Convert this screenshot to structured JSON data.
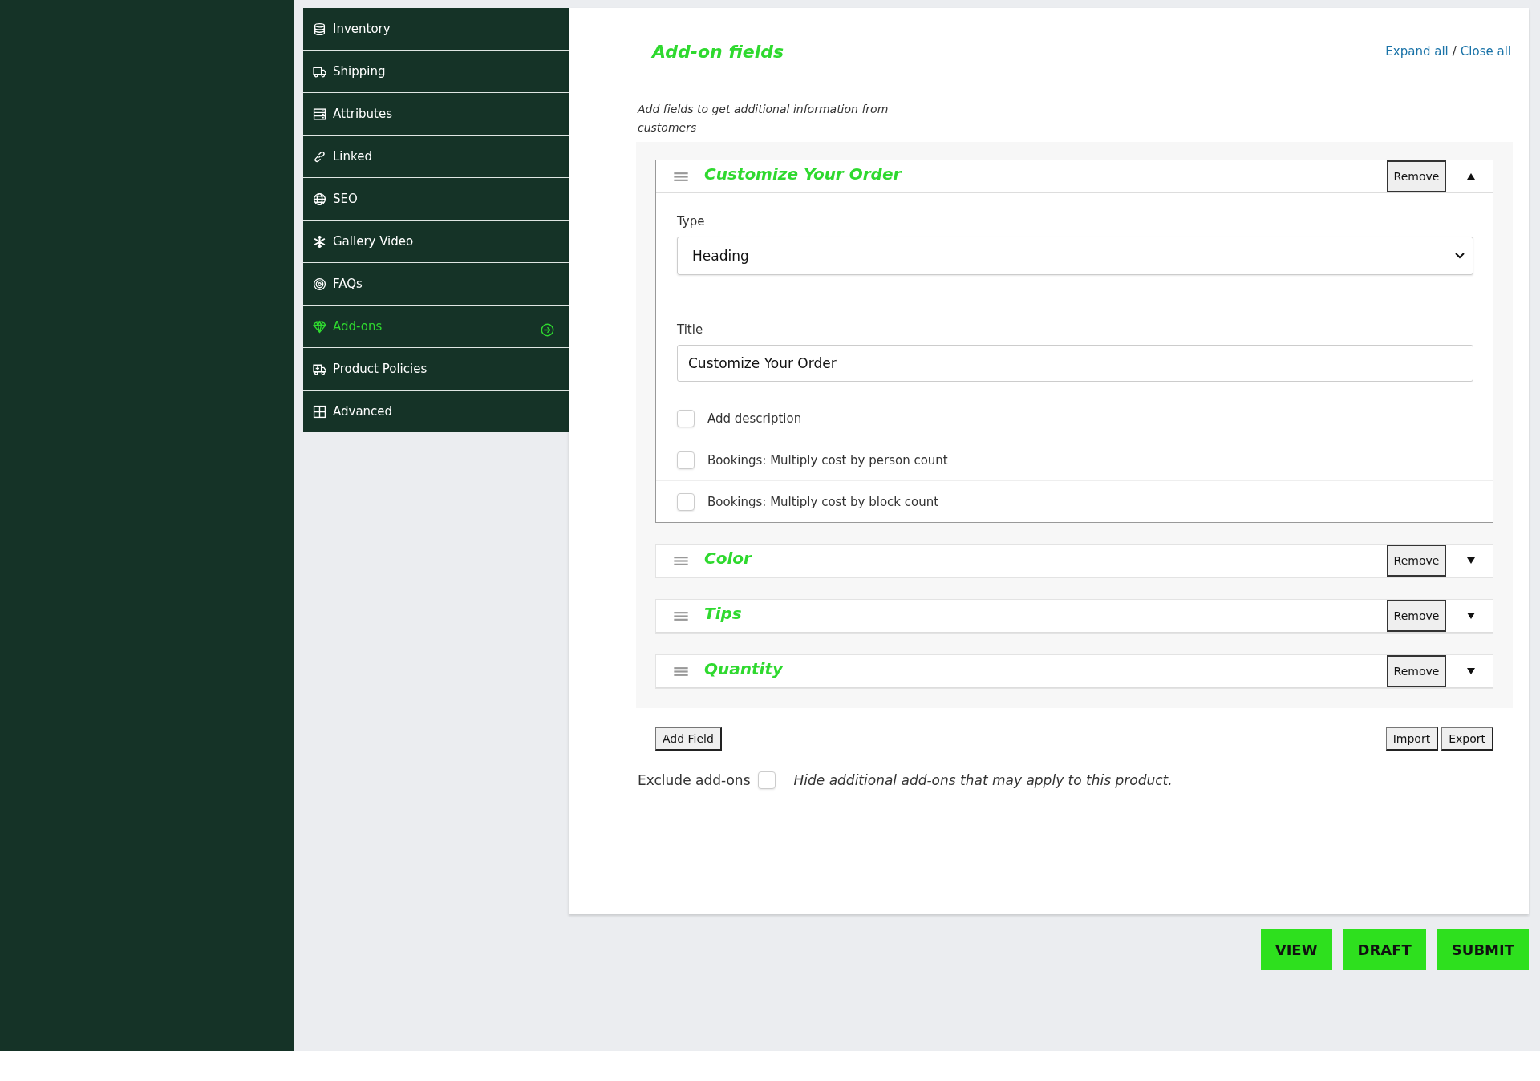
{
  "sidebar": {
    "items": [
      {
        "label": "Inventory",
        "selected": false
      },
      {
        "label": "Shipping",
        "selected": false
      },
      {
        "label": "Attributes",
        "selected": false
      },
      {
        "label": "Linked",
        "selected": false
      },
      {
        "label": "SEO",
        "selected": false
      },
      {
        "label": "Gallery Video",
        "selected": false
      },
      {
        "label": "FAQs",
        "selected": false
      },
      {
        "label": "Add-ons",
        "selected": true
      },
      {
        "label": "Product Policies",
        "selected": false
      },
      {
        "label": "Advanced",
        "selected": false
      }
    ]
  },
  "section": {
    "title": "Add-on fields",
    "expand_all": "Expand all",
    "separator": "/",
    "close_all": "Close all",
    "description": "Add fields to get additional information from customers"
  },
  "fields": [
    {
      "title": "Customize Your Order",
      "remove": "Remove",
      "expanded": true,
      "type_label": "Type",
      "type_value": "Heading",
      "title_label": "Title",
      "title_value": "Customize Your Order",
      "options": [
        {
          "label": "Add description",
          "checked": false
        },
        {
          "label": "Bookings: Multiply cost by person count",
          "checked": false
        },
        {
          "label": "Bookings: Multiply cost by block count",
          "checked": false
        }
      ]
    },
    {
      "title": "Color",
      "remove": "Remove",
      "expanded": false
    },
    {
      "title": "Tips",
      "remove": "Remove",
      "expanded": false
    },
    {
      "title": "Quantity",
      "remove": "Remove",
      "expanded": false
    }
  ],
  "actions": {
    "add_field": "Add Field",
    "import": "Import",
    "export": "Export"
  },
  "exclude": {
    "label": "Exclude add-ons",
    "checked": false,
    "hint": "Hide additional add-ons that may apply to this product."
  },
  "footer_buttons": [
    "VIEW",
    "DRAFT",
    "SUBMIT"
  ]
}
